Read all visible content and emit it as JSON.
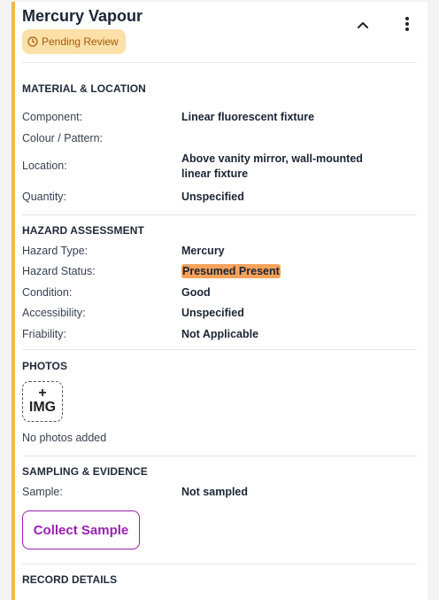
{
  "header": {
    "title": "Mercury Vapour",
    "status_badge": "Pending Review",
    "colors": {
      "accent_border": "#f2b84a",
      "badge_bg": "#fde0a8",
      "badge_text": "#a45a0a"
    },
    "icons": [
      "clock-icon",
      "chevron-up-icon",
      "more-vertical-icon"
    ]
  },
  "material": {
    "title": "MATERIAL & LOCATION",
    "component_label": "Component:",
    "component_value": "Linear fluorescent fixture",
    "colour_label": "Colour / Pattern:",
    "colour_value": "",
    "location_label": "Location:",
    "location_value": "Above vanity mirror, wall-mounted linear fixture",
    "quantity_label": "Quantity:",
    "quantity_value": "Unspecified"
  },
  "hazard": {
    "title": "HAZARD ASSESSMENT",
    "type_label": "Hazard Type:",
    "type_value": "Mercury",
    "status_label": "Hazard Status:",
    "status_value": "Presumed Present",
    "status_color": "#f6a25a",
    "condition_label": "Condition:",
    "condition_value": "Good",
    "accessibility_label": "Accessibility:",
    "accessibility_value": "Unspecified",
    "friability_label": "Friability:",
    "friability_value": "Not Applicable"
  },
  "photos": {
    "title": "PHOTOS",
    "add_plus": "+",
    "add_label": "IMG",
    "empty_text": "No photos added"
  },
  "sampling": {
    "title": "SAMPLING & EVIDENCE",
    "sample_label": "Sample:",
    "sample_value": "Not sampled",
    "collect_button": "Collect Sample",
    "button_color": "#9b1fb0"
  },
  "record": {
    "title": "RECORD DETAILS"
  }
}
